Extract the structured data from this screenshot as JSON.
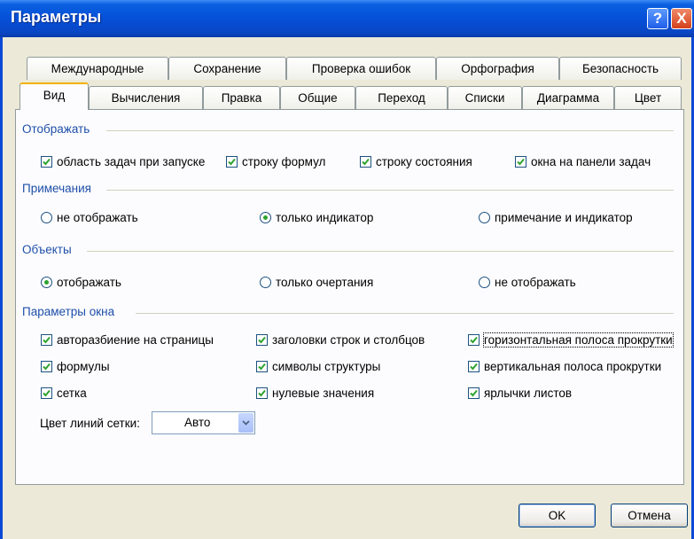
{
  "window": {
    "title": "Параметры",
    "help_label": "?",
    "close_label": "X"
  },
  "tabs": {
    "row_back": [
      "Международные",
      "Сохранение",
      "Проверка ошибок",
      "Орфография",
      "Безопасность"
    ],
    "row_front": [
      "Вид",
      "Вычисления",
      "Правка",
      "Общие",
      "Переход",
      "Списки",
      "Диаграмма",
      "Цвет"
    ],
    "active": "Вид"
  },
  "groups": {
    "display": {
      "label": "Отображать",
      "options": [
        {
          "label": "область задач при запуске",
          "checked": true
        },
        {
          "label": "строку формул",
          "checked": true
        },
        {
          "label": "строку состояния",
          "checked": true
        },
        {
          "label": "окна на панели задач",
          "checked": true
        }
      ]
    },
    "comments": {
      "label": "Примечания",
      "options": [
        {
          "label": "не отображать",
          "selected": false
        },
        {
          "label": "только индикатор",
          "selected": true
        },
        {
          "label": "примечание и индикатор",
          "selected": false
        }
      ]
    },
    "objects": {
      "label": "Объекты",
      "options": [
        {
          "label": "отображать",
          "selected": true
        },
        {
          "label": "только очертания",
          "selected": false
        },
        {
          "label": "не отображать",
          "selected": false
        }
      ]
    },
    "window_params": {
      "label": "Параметры окна",
      "options": [
        {
          "label": "авторазбиение на страницы",
          "checked": true
        },
        {
          "label": "заголовки строк и столбцов",
          "checked": true
        },
        {
          "label": "горизонтальная полоса прокрутки",
          "checked": true
        },
        {
          "label": "формулы",
          "checked": true
        },
        {
          "label": "символы структуры",
          "checked": true
        },
        {
          "label": "вертикальная полоса прокрутки",
          "checked": true
        },
        {
          "label": "сетка",
          "checked": true
        },
        {
          "label": "нулевые значения",
          "checked": true
        },
        {
          "label": "ярлычки листов",
          "checked": true
        }
      ]
    }
  },
  "grid_color": {
    "label": "Цвет линий сетки:",
    "value": "Авто"
  },
  "buttons": {
    "ok": "OK",
    "cancel": "Отмена"
  },
  "colors": {
    "title_bar": "#0550d8",
    "group_label": "#1e4fa8",
    "check": "#2fa32f"
  }
}
